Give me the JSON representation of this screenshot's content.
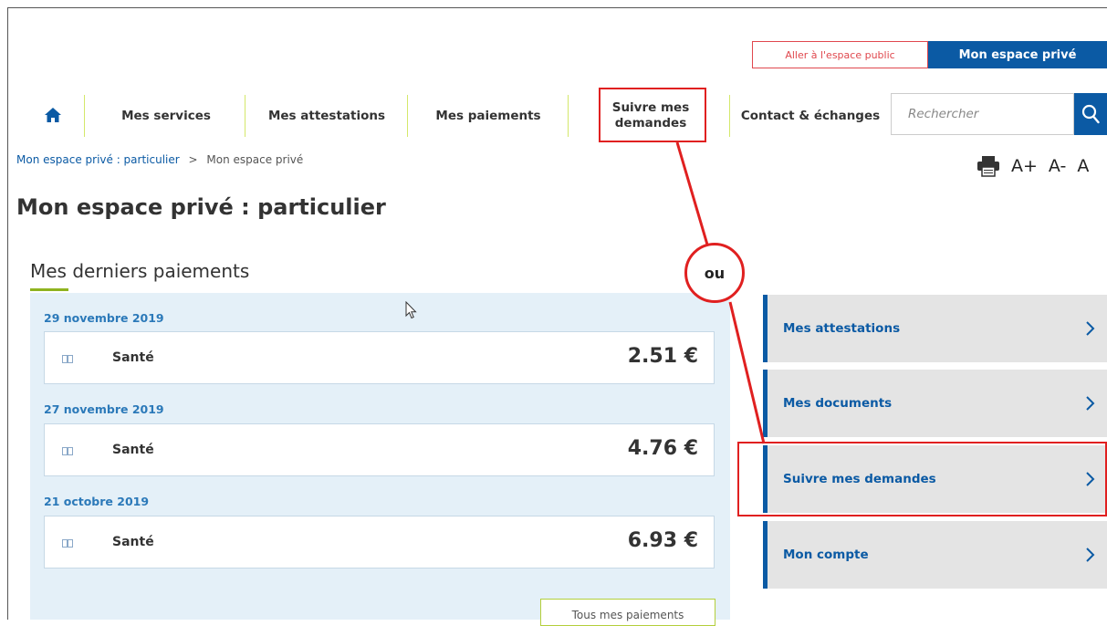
{
  "topbar": {
    "public_label": "Aller à l'espace public",
    "private_label": "Mon espace privé"
  },
  "nav": {
    "items": [
      {
        "label": "Mes services"
      },
      {
        "label": "Mes attestations"
      },
      {
        "label": "Mes paiements"
      },
      {
        "label": "Suivre mes demandes"
      },
      {
        "label": "Contact & échanges"
      }
    ],
    "search_placeholder": "Rechercher"
  },
  "breadcrumb": {
    "root": "Mon espace privé : particulier",
    "separator": ">",
    "current": "Mon espace privé"
  },
  "tools": {
    "font_increase": "A+",
    "font_decrease": "A-",
    "font_reset": "A"
  },
  "page_title": "Mon espace privé : particulier",
  "payments": {
    "title": "Mes derniers paiements",
    "items": [
      {
        "date": "29 novembre 2019",
        "label": "Santé",
        "amount": "2.51 €"
      },
      {
        "date": "27 novembre 2019",
        "label": "Santé",
        "amount": "4.76 €"
      },
      {
        "date": "21 octobre 2019",
        "label": "Santé",
        "amount": "6.93 €"
      }
    ],
    "all_button": "Tous mes paiements"
  },
  "side_menu": {
    "items": [
      {
        "label": "Mes attestations"
      },
      {
        "label": "Mes documents"
      },
      {
        "label": "Suivre mes demandes"
      },
      {
        "label": "Mon compte"
      }
    ]
  },
  "annotation": {
    "connector_label": "ou",
    "color": "#e02020"
  },
  "colors": {
    "brand_blue": "#0b5aa4",
    "accent_green": "#8fb31f",
    "public_red": "#e0484e",
    "panel_bg": "#e4f0f8"
  }
}
